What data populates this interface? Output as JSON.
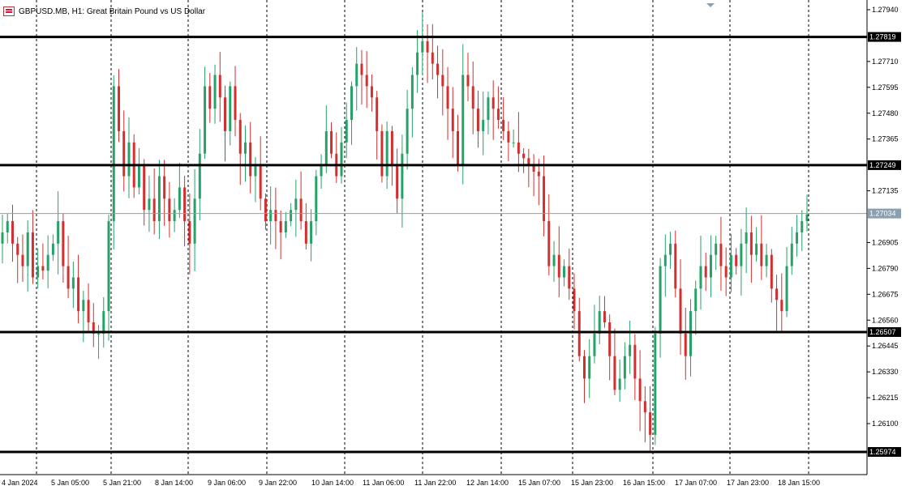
{
  "window": {
    "title": "GBPUSD.MB, H1:  Great Britain Pound vs US Dollar"
  },
  "colors": {
    "bull": "#26a269",
    "bear": "#d32f2f",
    "grid": "#000000",
    "level_line": "#000000",
    "bid_line": "#8aa0b0",
    "bid_label_bg": "#8aa0b0",
    "level_label_bg": "#000000"
  },
  "chart_data": {
    "type": "candlestick",
    "symbol": "GBPUSD.MB",
    "timeframe": "H1",
    "title": "GBPUSD.MB, H1:  Great Britain Pound vs US Dollar",
    "ylim": [
      1.2593,
      1.2798
    ],
    "grid": "vertical dashed",
    "y_ticks": [
      "1.27940",
      "1.27710",
      "1.27595",
      "1.27480",
      "1.27365",
      "1.27135",
      "1.26905",
      "1.26790",
      "1.26675",
      "1.26560",
      "1.26445",
      "1.26330",
      "1.26215",
      "1.26100"
    ],
    "x_ticks": [
      "4 Jan 2024",
      "5 Jan 05:00",
      "5 Jan 21:00",
      "8 Jan 14:00",
      "9 Jan 06:00",
      "9 Jan 22:00",
      "10 Jan 14:00",
      "11 Jan 06:00",
      "11 Jan 22:00",
      "12 Jan 14:00",
      "15 Jan 07:00",
      "15 Jan 23:00",
      "16 Jan 15:00",
      "17 Jan 07:00",
      "17 Jan 23:00",
      "18 Jan 15:00"
    ],
    "horizontal_levels": [
      "1.27819",
      "1.27249",
      "1.26507",
      "1.25974"
    ],
    "bid_price": "1.27034",
    "bid_value": 1.27034,
    "key_prices": [
      1.2695,
      1.27,
      1.269,
      1.2685,
      1.268,
      1.2695,
      1.2675,
      1.268,
      1.2678,
      1.2685,
      1.269,
      1.27,
      1.268,
      1.267,
      1.2675,
      1.266,
      1.2665,
      1.2655,
      1.265,
      1.265,
      1.266,
      1.27,
      1.276,
      1.274,
      1.272,
      1.2735,
      1.2715,
      1.2725,
      1.2705,
      1.271,
      1.27,
      1.272,
      1.271,
      1.27,
      1.2705,
      1.2715,
      1.27,
      1.269,
      1.271,
      1.273,
      1.276,
      1.275,
      1.2765,
      1.2755,
      1.274,
      1.276,
      1.2745,
      1.273,
      1.2735,
      1.272,
      1.2725,
      1.271,
      1.27,
      1.2705,
      1.27,
      1.2695,
      1.27,
      1.2705,
      1.271,
      1.27,
      1.269,
      1.27,
      1.272,
      1.2725,
      1.274,
      1.273,
      1.272,
      1.2735,
      1.2745,
      1.276,
      1.277,
      1.2765,
      1.276,
      1.2755,
      1.274,
      1.272,
      1.274,
      1.2725,
      1.271,
      1.273,
      1.275,
      1.2765,
      1.2775,
      1.278,
      1.2775,
      1.277,
      1.2765,
      1.276,
      1.275,
      1.274,
      1.2725,
      1.2765,
      1.276,
      1.275,
      1.274,
      1.2745,
      1.2755,
      1.275,
      1.2745,
      1.274,
      1.2735,
      1.2735,
      1.273,
      1.2728,
      1.2725,
      1.2722,
      1.272,
      1.27,
      1.268,
      1.2685,
      1.2675,
      1.268,
      1.267,
      1.266,
      1.264,
      1.263,
      1.264,
      1.265,
      1.266,
      1.2655,
      1.264,
      1.2625,
      1.263,
      1.264,
      1.2645,
      1.263,
      1.262,
      1.2615,
      1.2605,
      1.265,
      1.268,
      1.2685,
      1.269,
      1.267,
      1.265,
      1.264,
      1.266,
      1.267,
      1.268,
      1.2675,
      1.2685,
      1.269,
      1.268,
      1.2675,
      1.2685,
      1.268,
      1.269,
      1.2695,
      1.2685,
      1.269,
      1.268,
      1.2685,
      1.267,
      1.2665,
      1.266,
      1.268,
      1.269,
      1.2695,
      1.27,
      1.2703
    ]
  }
}
